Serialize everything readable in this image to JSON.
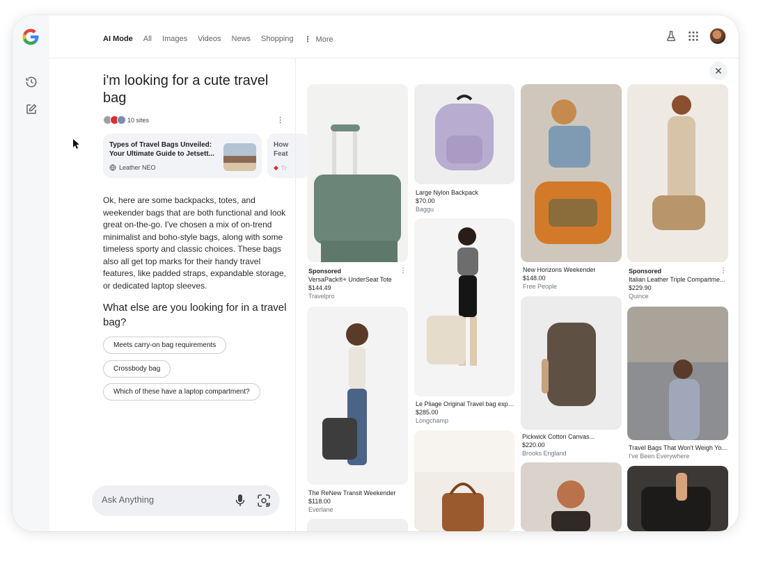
{
  "nav": {
    "tabs": [
      {
        "label": "AI Mode",
        "active": true
      },
      {
        "label": "All"
      },
      {
        "label": "Images"
      },
      {
        "label": "Videos"
      },
      {
        "label": "News"
      },
      {
        "label": "Shopping"
      },
      {
        "label": "More"
      }
    ]
  },
  "conversation": {
    "query": "i'm looking for a cute travel bag",
    "sites_count": "10 sites",
    "cards": [
      {
        "title": "Types of Travel Bags Unveiled: Your Ultimate Guide to Jetsett...",
        "source": "Leather NEO"
      },
      {
        "title": "How Feat",
        "source": "Tr"
      }
    ],
    "answer": "Ok, here are some backpacks, totes, and weekender bags that are both functional and look great on-the-go. I've chosen a mix of on-trend minimalist and boho-style bags, along with some timeless sporty and classic choices. These bags also all get top marks for their handy travel features, like padded straps, expandable storage, or dedicated laptop sleeves.",
    "follow_up_question": "What else are you looking for in a travel bag?",
    "chips": [
      "Meets carry-on bag requirements",
      "Crossbody bag",
      "Which of these have a laptop compartment?"
    ]
  },
  "ask": {
    "placeholder": "Ask Anything"
  },
  "products": [
    {
      "sponsored": "Sponsored",
      "name": "VersaPack®+ UnderSeat Tote",
      "price": "$144.49",
      "store": "Travelpro"
    },
    {
      "sponsored": "",
      "name": "The ReNew Transit Weekender",
      "price": "$118.00",
      "store": "Everlane"
    },
    {
      "sponsored": "",
      "name": "Large Nylon Backpack",
      "price": "$70.00",
      "store": "Baggu"
    },
    {
      "sponsored": "",
      "name": "Le Pliage Original Travel bag expa...",
      "price": "$285.00",
      "store": "Longchamp"
    },
    {
      "sponsored": "",
      "name": "New Horizons Weekender",
      "price": "$148.00",
      "store": "Free People"
    },
    {
      "sponsored": "",
      "name": "Pickwick Cotton Canvas...",
      "price": "$220.00",
      "store": "Brooks England"
    },
    {
      "sponsored": "Sponsored",
      "name": "Italian Leather Triple Compartme...",
      "price": "$229.90",
      "store": "Quince"
    },
    {
      "sponsored": "",
      "name": "Travel Bags That Won't Weigh Yo...",
      "price": "",
      "store": "I've Been Everywhere"
    }
  ],
  "icons": {
    "logo": "google-g-logo",
    "rail": [
      "history-icon",
      "new-chat-icon"
    ],
    "top": [
      "labs-flask-icon",
      "apps-grid-icon",
      "account-avatar"
    ],
    "ask": [
      "microphone-icon",
      "lens-camera-icon"
    ],
    "close": "close-icon"
  }
}
